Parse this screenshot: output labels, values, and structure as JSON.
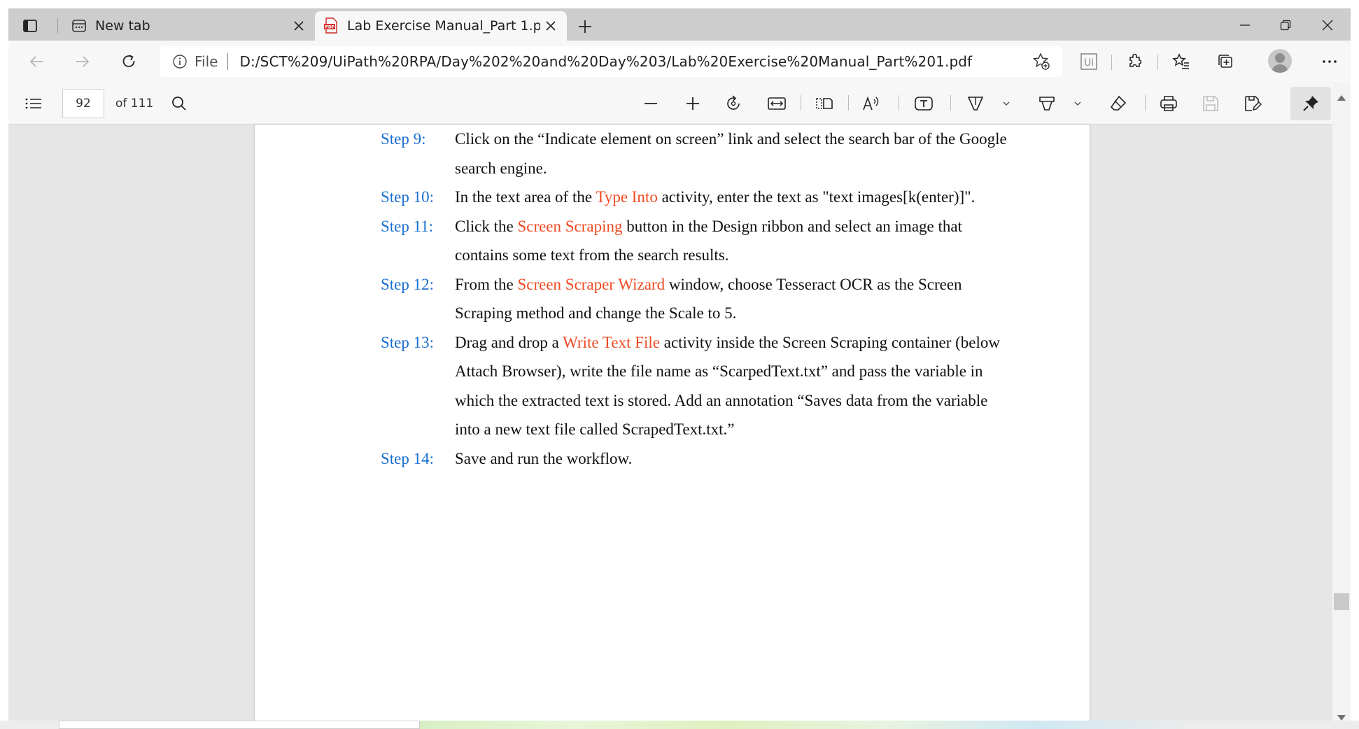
{
  "browser": {
    "tabs": [
      {
        "title": "New tab",
        "icon": "new-tab-icon",
        "active": false
      },
      {
        "title": "Lab Exercise Manual_Part 1.pdf",
        "icon": "pdf-file-icon",
        "active": true
      }
    ],
    "address": {
      "scheme_label": "File",
      "url": "D:/SCT%209/UiPath%20RPA/Day%202%20and%20Day%203/Lab%20Exercise%20Manual_Part%201.pdf"
    },
    "extension_label": "Ui"
  },
  "pdf_toolbar": {
    "page_number": "92",
    "page_count": "of 111"
  },
  "document": {
    "top_fragment": "",
    "steps": [
      {
        "label": "Step 9:",
        "parts": [
          {
            "text": "Click on the “Indicate element on screen” link and select the search bar of the Google search engine.",
            "highlight": false
          }
        ]
      },
      {
        "label": "Step 10:",
        "parts": [
          {
            "text": "In the text area of the ",
            "highlight": false
          },
          {
            "text": "Type Into",
            "highlight": true
          },
          {
            "text": " activity, enter the text as \"text images[k(enter)]\".",
            "highlight": false
          }
        ]
      },
      {
        "label": "Step 11:",
        "parts": [
          {
            "text": "Click the ",
            "highlight": false
          },
          {
            "text": "Screen Scraping",
            "highlight": true
          },
          {
            "text": " button in the Design ribbon and select an image that contains some text from the search results.",
            "highlight": false
          }
        ]
      },
      {
        "label": "Step 12:",
        "parts": [
          {
            "text": "From the ",
            "highlight": false
          },
          {
            "text": "Screen Scraper Wizard",
            "highlight": true
          },
          {
            "text": " window, choose Tesseract OCR as the Screen Scraping method and change the Scale to 5.",
            "highlight": false
          }
        ]
      },
      {
        "label": "Step 13:",
        "parts": [
          {
            "text": "Drag and drop a ",
            "highlight": false
          },
          {
            "text": "Write Text File",
            "highlight": true
          },
          {
            "text": " activity inside the Screen Scraping container (below Attach Browser), write the file name as “ScarpedText.txt” and pass the variable in which the extracted text is stored. Add an annotation “Saves data from the variable into a new text file called ScrapedText.txt.”",
            "highlight": false
          }
        ]
      },
      {
        "label": "Step 14:",
        "parts": [
          {
            "text": "Save and run the workflow.",
            "highlight": false
          }
        ]
      }
    ]
  },
  "colors": {
    "step_label": "#1a6fd0",
    "highlight": "#f04a23"
  }
}
